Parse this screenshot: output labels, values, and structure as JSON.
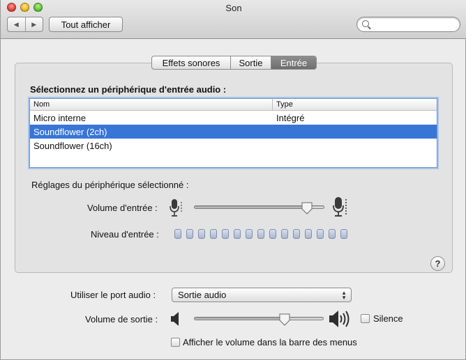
{
  "window": {
    "title": "Son"
  },
  "toolbar": {
    "back_glyph": "◀",
    "forward_glyph": "▶",
    "show_all_label": "Tout afficher",
    "search_value": ""
  },
  "tabs": [
    {
      "label": "Effets sonores",
      "selected": false
    },
    {
      "label": "Sortie",
      "selected": false
    },
    {
      "label": "Entrée",
      "selected": true
    }
  ],
  "input_panel": {
    "title": "Sélectionnez un périphérique d'entrée audio :",
    "columns": {
      "name": "Nom",
      "type": "Type"
    },
    "devices": [
      {
        "name": "Micro interne",
        "type": "Intégré",
        "selected": false
      },
      {
        "name": "Soundflower (2ch)",
        "type": "",
        "selected": true
      },
      {
        "name": "Soundflower (16ch)",
        "type": "",
        "selected": false
      }
    ],
    "settings_title": "Réglages du périphérique sélectionné :",
    "input_volume_label": "Volume d'entrée :",
    "input_volume": 0.9,
    "input_level_label": "Niveau d'entrée :",
    "input_level_bars": 15,
    "input_level_active": 0,
    "help_label": "?"
  },
  "bottom": {
    "audio_port_label": "Utiliser le port audio :",
    "audio_port_value": "Sortie audio",
    "output_volume_label": "Volume de sortie :",
    "output_volume": 0.72,
    "mute_label": "Silence",
    "mute_checked": false,
    "show_menubar_label": "Afficher le volume dans la barre des menus",
    "show_menubar_checked": false
  },
  "colors": {
    "selection": "#3875d7",
    "active_tab": "#7c7c7c"
  },
  "icons": {
    "mic_small": "microphone-icon",
    "mic_large": "microphone-icon",
    "speaker_low": "speaker-low-icon",
    "speaker_high": "speaker-high-icon",
    "search": "search-icon"
  }
}
